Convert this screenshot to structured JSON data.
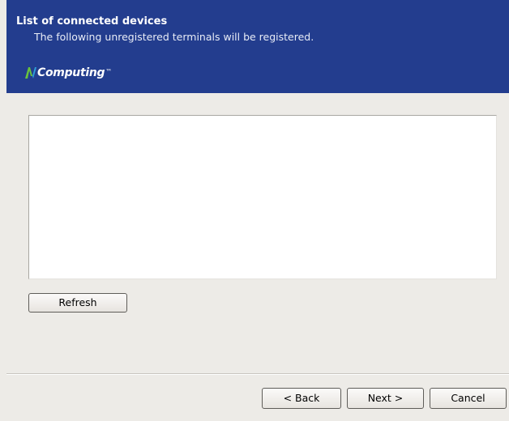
{
  "header": {
    "title": "List of connected devices",
    "subtitle": "The following unregistered terminals will be registered.",
    "brand": {
      "name": "NComputing",
      "mark_letter": "N",
      "text_after_mark": "Computing",
      "trademark": "™",
      "colors": {
        "mark_green": "#69c33b",
        "mark_blue": "#2e9fd9"
      }
    },
    "background_color": "#233d8e"
  },
  "device_list": {
    "items": []
  },
  "buttons": {
    "refresh": "Refresh",
    "back": "< Back",
    "next": "Next >",
    "cancel": "Cancel"
  }
}
